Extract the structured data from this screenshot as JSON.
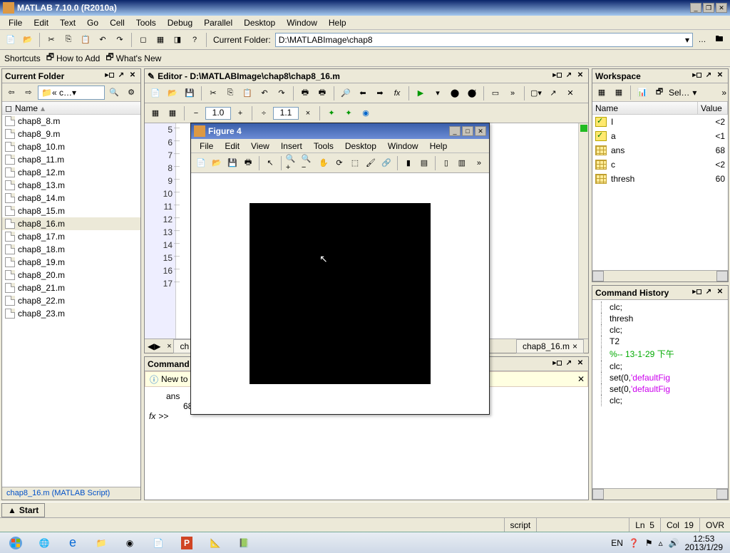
{
  "app": {
    "title": "MATLAB  7.10.0  (R2010a)"
  },
  "menus": {
    "main": [
      "File",
      "Edit",
      "Text",
      "Go",
      "Cell",
      "Tools",
      "Debug",
      "Parallel",
      "Desktop",
      "Window",
      "Help"
    ],
    "figure": [
      "File",
      "Edit",
      "View",
      "Insert",
      "Tools",
      "Desktop",
      "Window",
      "Help"
    ]
  },
  "toolbar": {
    "folder_label": "Current Folder:",
    "folder_path": "D:\\MATLABImage\\chap8"
  },
  "shortcuts": {
    "label": "Shortcuts",
    "howto": "How to Add",
    "whatsnew": "What's New"
  },
  "currentFolder": {
    "title": "Current Folder",
    "breadcrumb": "« c…",
    "header": "Name",
    "files": [
      "chap8_8.m",
      "chap8_9.m",
      "chap8_10.m",
      "chap8_11.m",
      "chap8_12.m",
      "chap8_13.m",
      "chap8_14.m",
      "chap8_15.m",
      "chap8_16.m",
      "chap8_17.m",
      "chap8_18.m",
      "chap8_19.m",
      "chap8_20.m",
      "chap8_21.m",
      "chap8_22.m",
      "chap8_23.m"
    ],
    "selected": 8,
    "status": "chap8_16.m (MATLAB Script)"
  },
  "editor": {
    "title": "Editor - D:\\MATLABImage\\chap8\\chap8_16.m",
    "zoom1": "1.0",
    "zoom2": "1.1",
    "lines": [
      "5",
      "6",
      "7",
      "8",
      "9",
      "10",
      "11",
      "12",
      "13",
      "14",
      "15",
      "16",
      "17"
    ],
    "tab_left": "ch",
    "tab_right": "chap8_16.m"
  },
  "commandWindow": {
    "title": "Command V",
    "hint_icon": "ⓘ",
    "hint": "New to M",
    "ans_label": "ans",
    "ans_value": "68",
    "fx": "fx",
    "prompt": ">>"
  },
  "workspace": {
    "title": "Workspace",
    "sel_label": "Sel…",
    "cols": {
      "name": "Name",
      "value": "Value"
    },
    "vars": [
      {
        "icon": "yellow",
        "name": "I",
        "value": "<2"
      },
      {
        "icon": "yellow",
        "name": "a",
        "value": "<1"
      },
      {
        "icon": "grid",
        "name": "ans",
        "value": "68"
      },
      {
        "icon": "grid",
        "name": "c",
        "value": "<2"
      },
      {
        "icon": "grid",
        "name": "thresh",
        "value": "60"
      }
    ]
  },
  "history": {
    "title": "Command History",
    "items": [
      {
        "t": "clc;"
      },
      {
        "t": "thresh"
      },
      {
        "t": "clc;"
      },
      {
        "t": "T2"
      },
      {
        "t": "%-- 13-1-29   下午",
        "cls": "date"
      },
      {
        "t": "clc;"
      },
      {
        "t": "set(0,",
        "str": "'defaultFig"
      },
      {
        "t": "set(0,",
        "str": "'defaultFig"
      },
      {
        "t": "clc;"
      }
    ]
  },
  "figure": {
    "title": "Figure 4"
  },
  "startbtn": "Start",
  "status": {
    "mode": "script",
    "ln_label": "Ln",
    "ln": "5",
    "col_label": "Col",
    "col": "19",
    "ovr": "OVR"
  },
  "taskbar": {
    "start": "Start",
    "lang": "EN",
    "time": "12:53",
    "date": "2013/1/29"
  }
}
